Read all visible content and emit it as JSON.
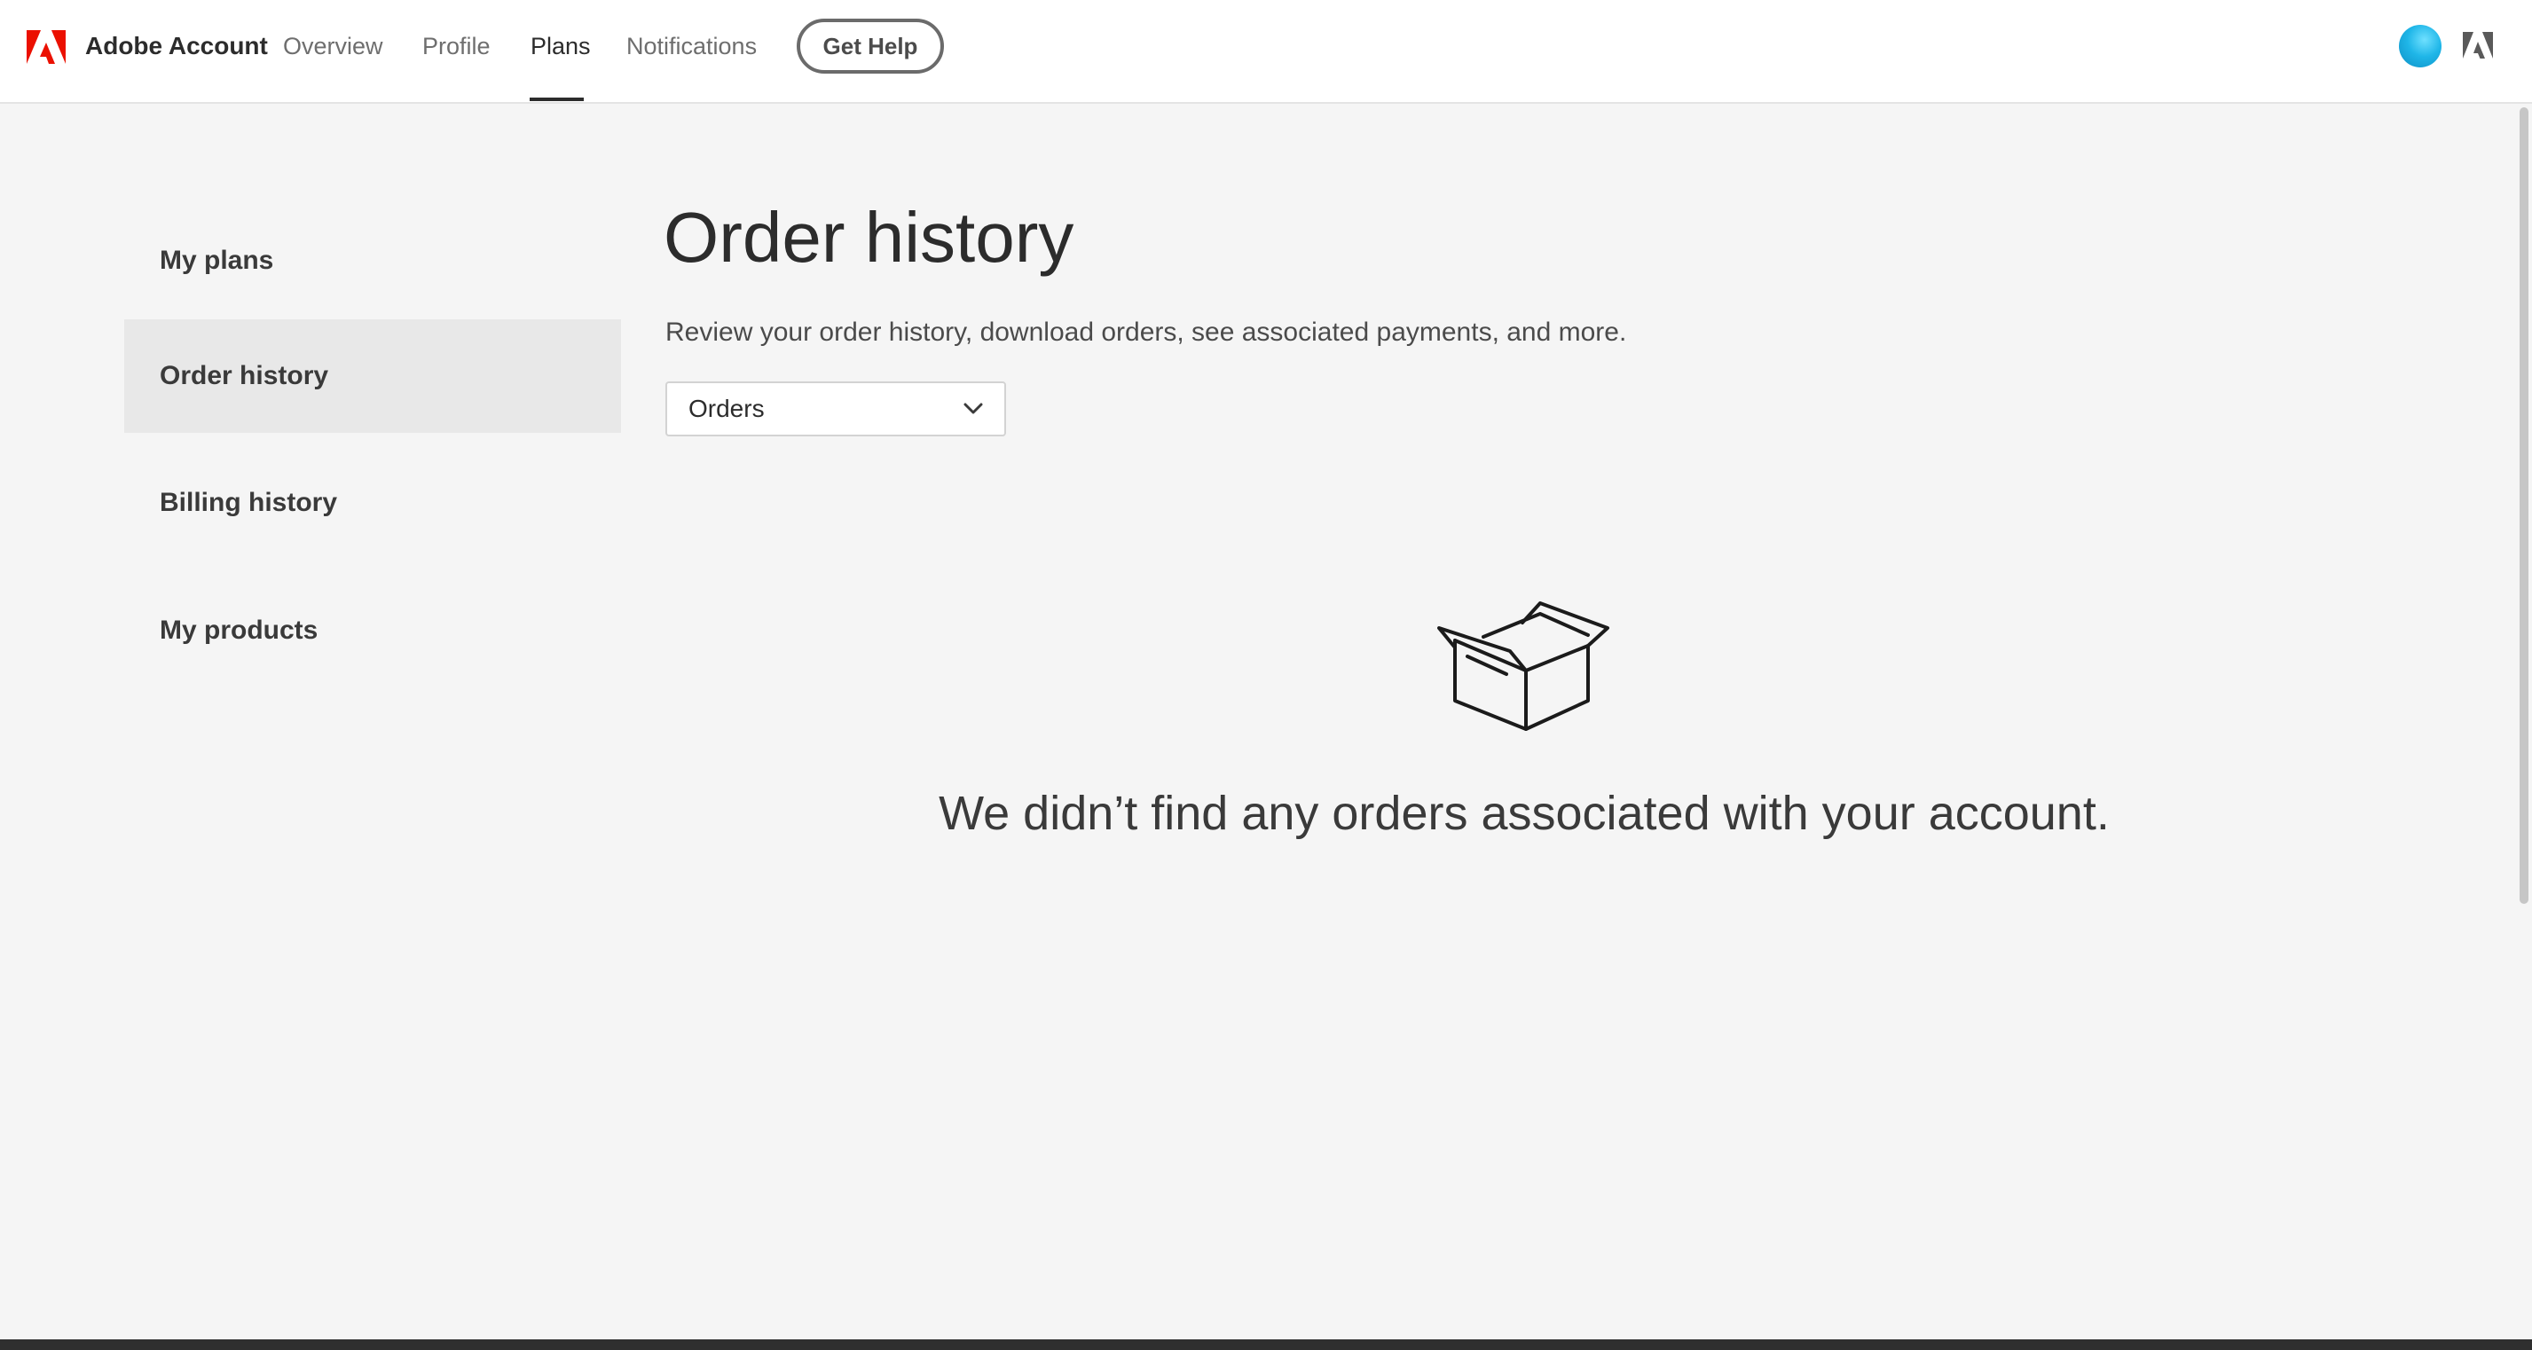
{
  "header": {
    "brand": "Adobe Account",
    "nav": [
      {
        "label": "Overview"
      },
      {
        "label": "Profile"
      },
      {
        "label": "Plans",
        "active": true
      },
      {
        "label": "Notifications"
      }
    ],
    "help_button": "Get Help",
    "logo_icon": "adobe-logo-icon",
    "brand_color": "#eb1000"
  },
  "sidebar": {
    "items": [
      {
        "label": "My plans"
      },
      {
        "label": "Order history",
        "active": true
      },
      {
        "label": "Billing history"
      },
      {
        "label": "My products"
      }
    ]
  },
  "main": {
    "title": "Order history",
    "subtitle": "Review your order history, download orders, see associated payments, and more.",
    "filter": {
      "selected": "Orders",
      "icon": "chevron-down-icon"
    },
    "empty_state": {
      "icon": "open-box-icon",
      "message": "We didn’t find any orders associated with your account."
    }
  }
}
